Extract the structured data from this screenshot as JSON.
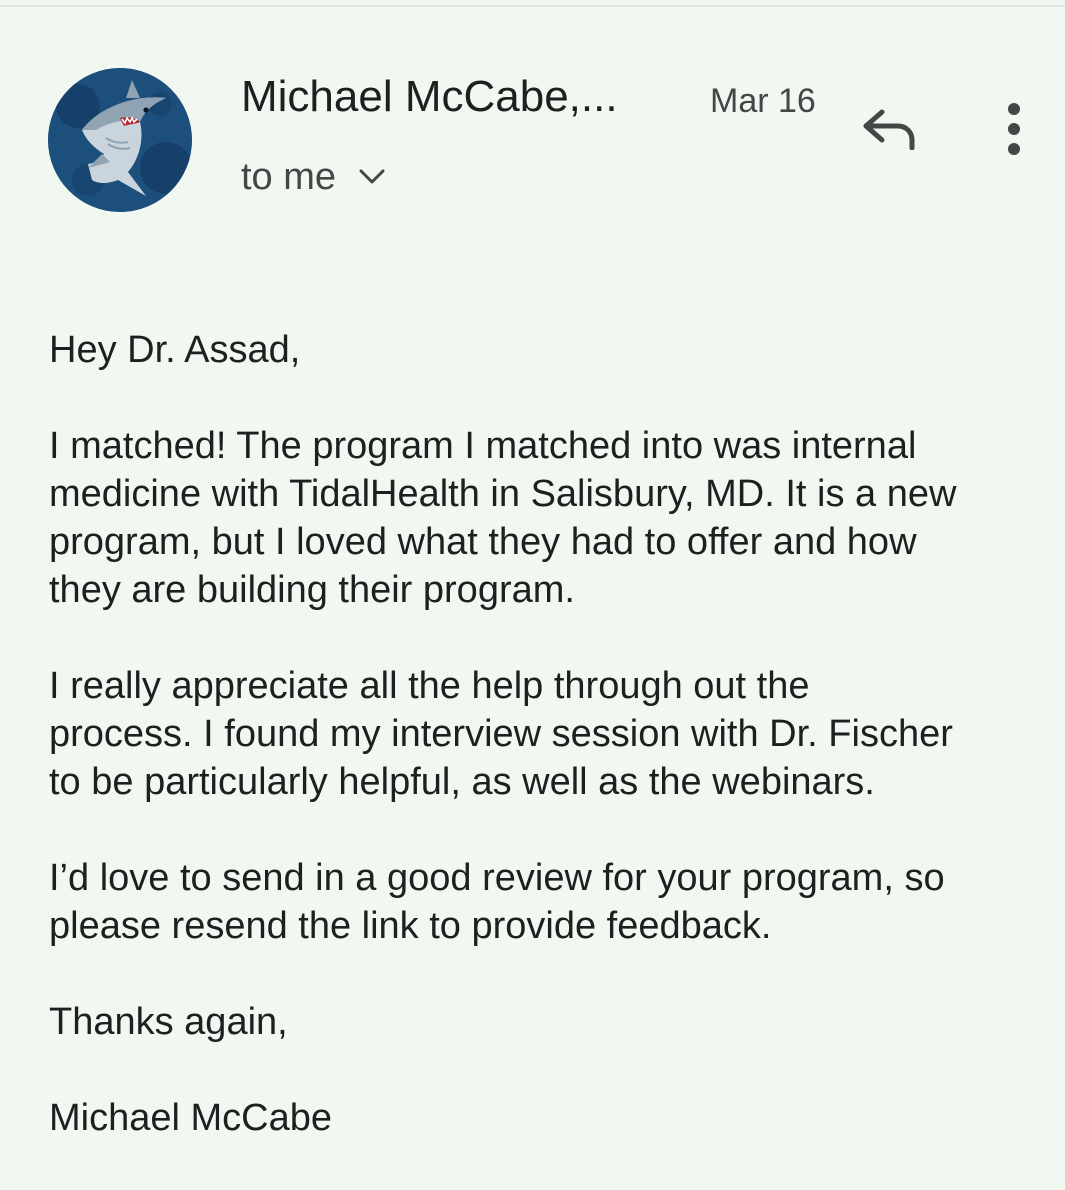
{
  "header": {
    "sender_name": "Michael McCabe,...",
    "date": "Mar 16",
    "recipient_label": "to me",
    "avatar_icon": "shark-icon",
    "reply_icon": "reply-icon",
    "more_icon": "more-vert-icon",
    "chevron_icon": "chevron-down-icon"
  },
  "message": {
    "paragraphs": [
      "Hey Dr. Assad,",
      "I matched! The program I matched into was internal\nmedicine with TidalHealth in Salisbury, MD. It is a new\nprogram, but I loved what they had to offer and how\nthey are building their program.",
      "I really appreciate all the help through out the\nprocess. I found my interview session with Dr. Fischer\nto be particularly helpful, as well as the webinars.",
      "I’d love to send in a good review for your program, so\nplease resend the link to provide feedback.",
      "Thanks again,",
      "Michael McCabe"
    ]
  },
  "colors": {
    "background": "#f1f8f2",
    "avatar_bg": "#1d4f7c",
    "text_primary": "#1f1f1f",
    "text_secondary": "#444746"
  }
}
